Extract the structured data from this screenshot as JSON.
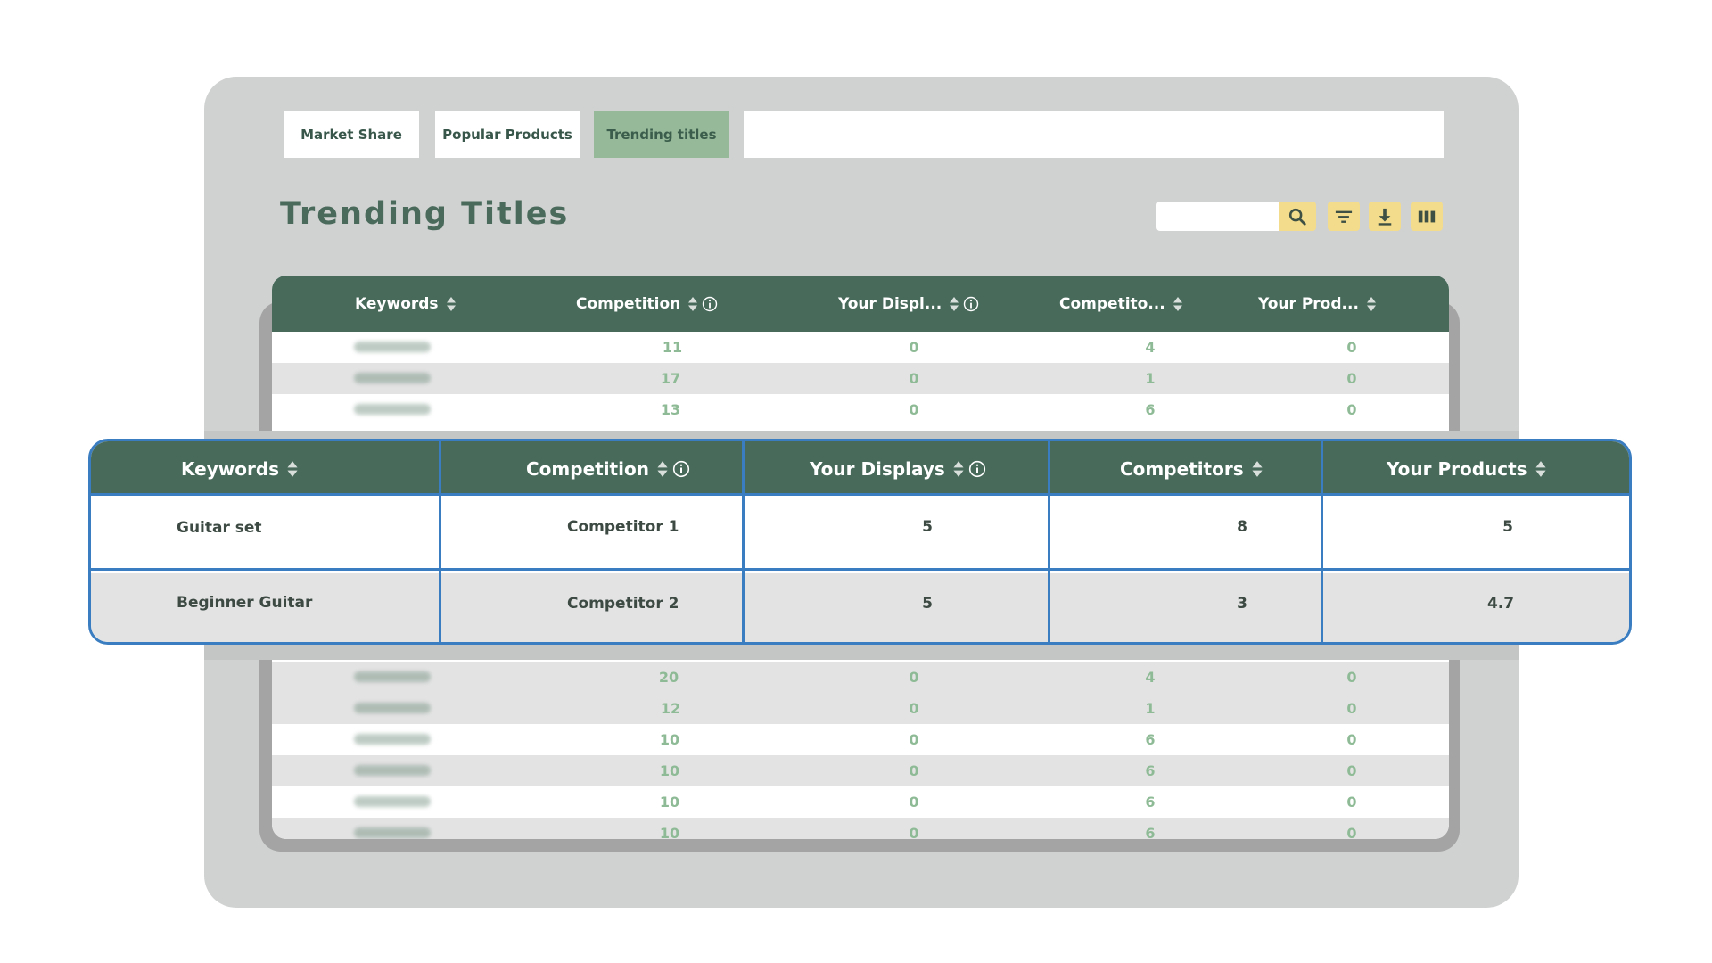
{
  "tabs": [
    {
      "label": "Market Share",
      "active": false
    },
    {
      "label": "Popular Products",
      "active": false
    },
    {
      "label": "Trending titles",
      "active": true
    }
  ],
  "page_title": "Trending Titles",
  "search": {
    "value": ""
  },
  "toolbar": {
    "search_icon": "search-icon",
    "filter_icon": "filter-icon",
    "download_icon": "download-icon",
    "columns_icon": "columns-icon"
  },
  "background_table": {
    "columns": [
      "Keywords",
      "Competition",
      "Your Displ...",
      "Competito...",
      "Your Prod..."
    ],
    "rows": [
      {
        "competition": "11",
        "your_displays": "0",
        "competitors": "4",
        "your_products": "0"
      },
      {
        "competition": "17",
        "your_displays": "0",
        "competitors": "1",
        "your_products": "0"
      },
      {
        "competition": "13",
        "your_displays": "0",
        "competitors": "6",
        "your_products": "0"
      },
      {
        "competition": "20",
        "your_displays": "0",
        "competitors": "4",
        "your_products": "0"
      },
      {
        "competition": "12",
        "your_displays": "0",
        "competitors": "1",
        "your_products": "0"
      },
      {
        "competition": "10",
        "your_displays": "0",
        "competitors": "6",
        "your_products": "0"
      },
      {
        "competition": "10",
        "your_displays": "0",
        "competitors": "6",
        "your_products": "0"
      },
      {
        "competition": "10",
        "your_displays": "0",
        "competitors": "6",
        "your_products": "0"
      },
      {
        "competition": "10",
        "your_displays": "0",
        "competitors": "6",
        "your_products": "0"
      }
    ]
  },
  "overlay_table": {
    "columns": [
      "Keywords",
      "Competition",
      "Your Displays",
      "Competitors",
      "Your Products"
    ],
    "rows": [
      {
        "keyword": "Guitar set",
        "competition": "Competitor 1",
        "your_displays": "5",
        "competitors": "8",
        "your_products": "5"
      },
      {
        "keyword": "Beginner Guitar",
        "competition": "Competitor 2",
        "your_displays": "5",
        "competitors": "3",
        "your_products": "4.7"
      }
    ]
  },
  "colors": {
    "header_green": "#476a5b",
    "accent_yellow": "#f3dc8c",
    "active_tab": "#95b999",
    "value_green": "#8ebb95",
    "overlay_border": "#3a7dc0"
  }
}
